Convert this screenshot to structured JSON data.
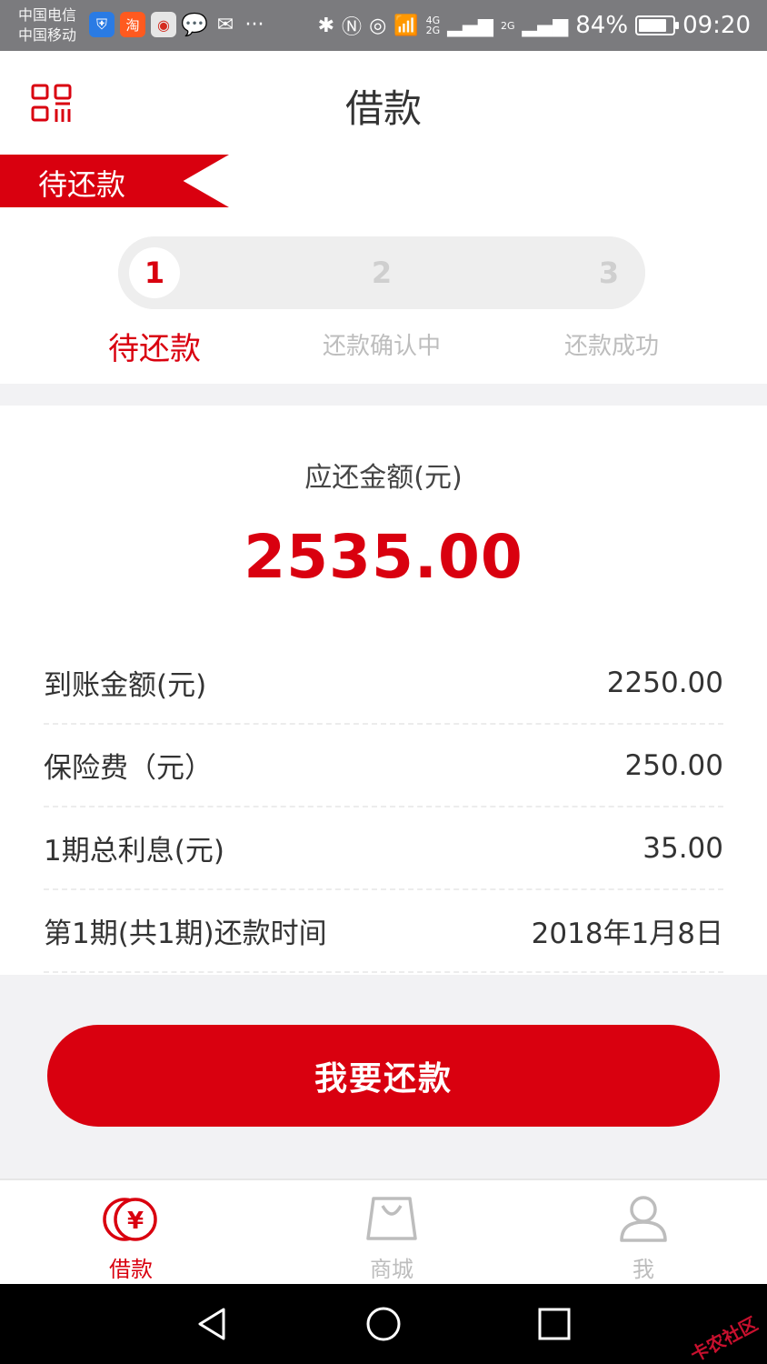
{
  "status_bar": {
    "carrier_1": "中国电信",
    "carrier_2": "中国移动",
    "battery": "84%",
    "time": "09:20",
    "net_1": "4G",
    "net_2": "2G",
    "net_3": "2G",
    "battery_level": 0.84
  },
  "header": {
    "title": "借款",
    "left_icon": "qr-code-icon"
  },
  "ribbon": {
    "label": "待还款"
  },
  "steps": [
    {
      "number": "1",
      "label": "待还款",
      "active": true
    },
    {
      "number": "2",
      "label": "还款确认中",
      "active": false
    },
    {
      "number": "3",
      "label": "还款成功",
      "active": false
    }
  ],
  "amount": {
    "label": "应还金额(元)",
    "value": "2535.00"
  },
  "details": [
    {
      "key": "到账金额(元)",
      "value": "2250.00"
    },
    {
      "key": "保险费（元）",
      "value": "250.00"
    },
    {
      "key": "1期总利息(元)",
      "value": "35.00"
    },
    {
      "key": "第1期(共1期)还款时间",
      "value": "2018年1月8日"
    }
  ],
  "repay_button": {
    "label": "我要还款"
  },
  "tabs": [
    {
      "label": "借款",
      "icon": "yuan-coin-icon",
      "active": true
    },
    {
      "label": "商城",
      "icon": "shopping-bag-icon",
      "active": false
    },
    {
      "label": "我",
      "icon": "user-icon",
      "active": false
    }
  ],
  "colors": {
    "accent": "#d9000f",
    "inactive": "#bdbdbd",
    "text": "#333333"
  },
  "watermark": "卡农社区"
}
